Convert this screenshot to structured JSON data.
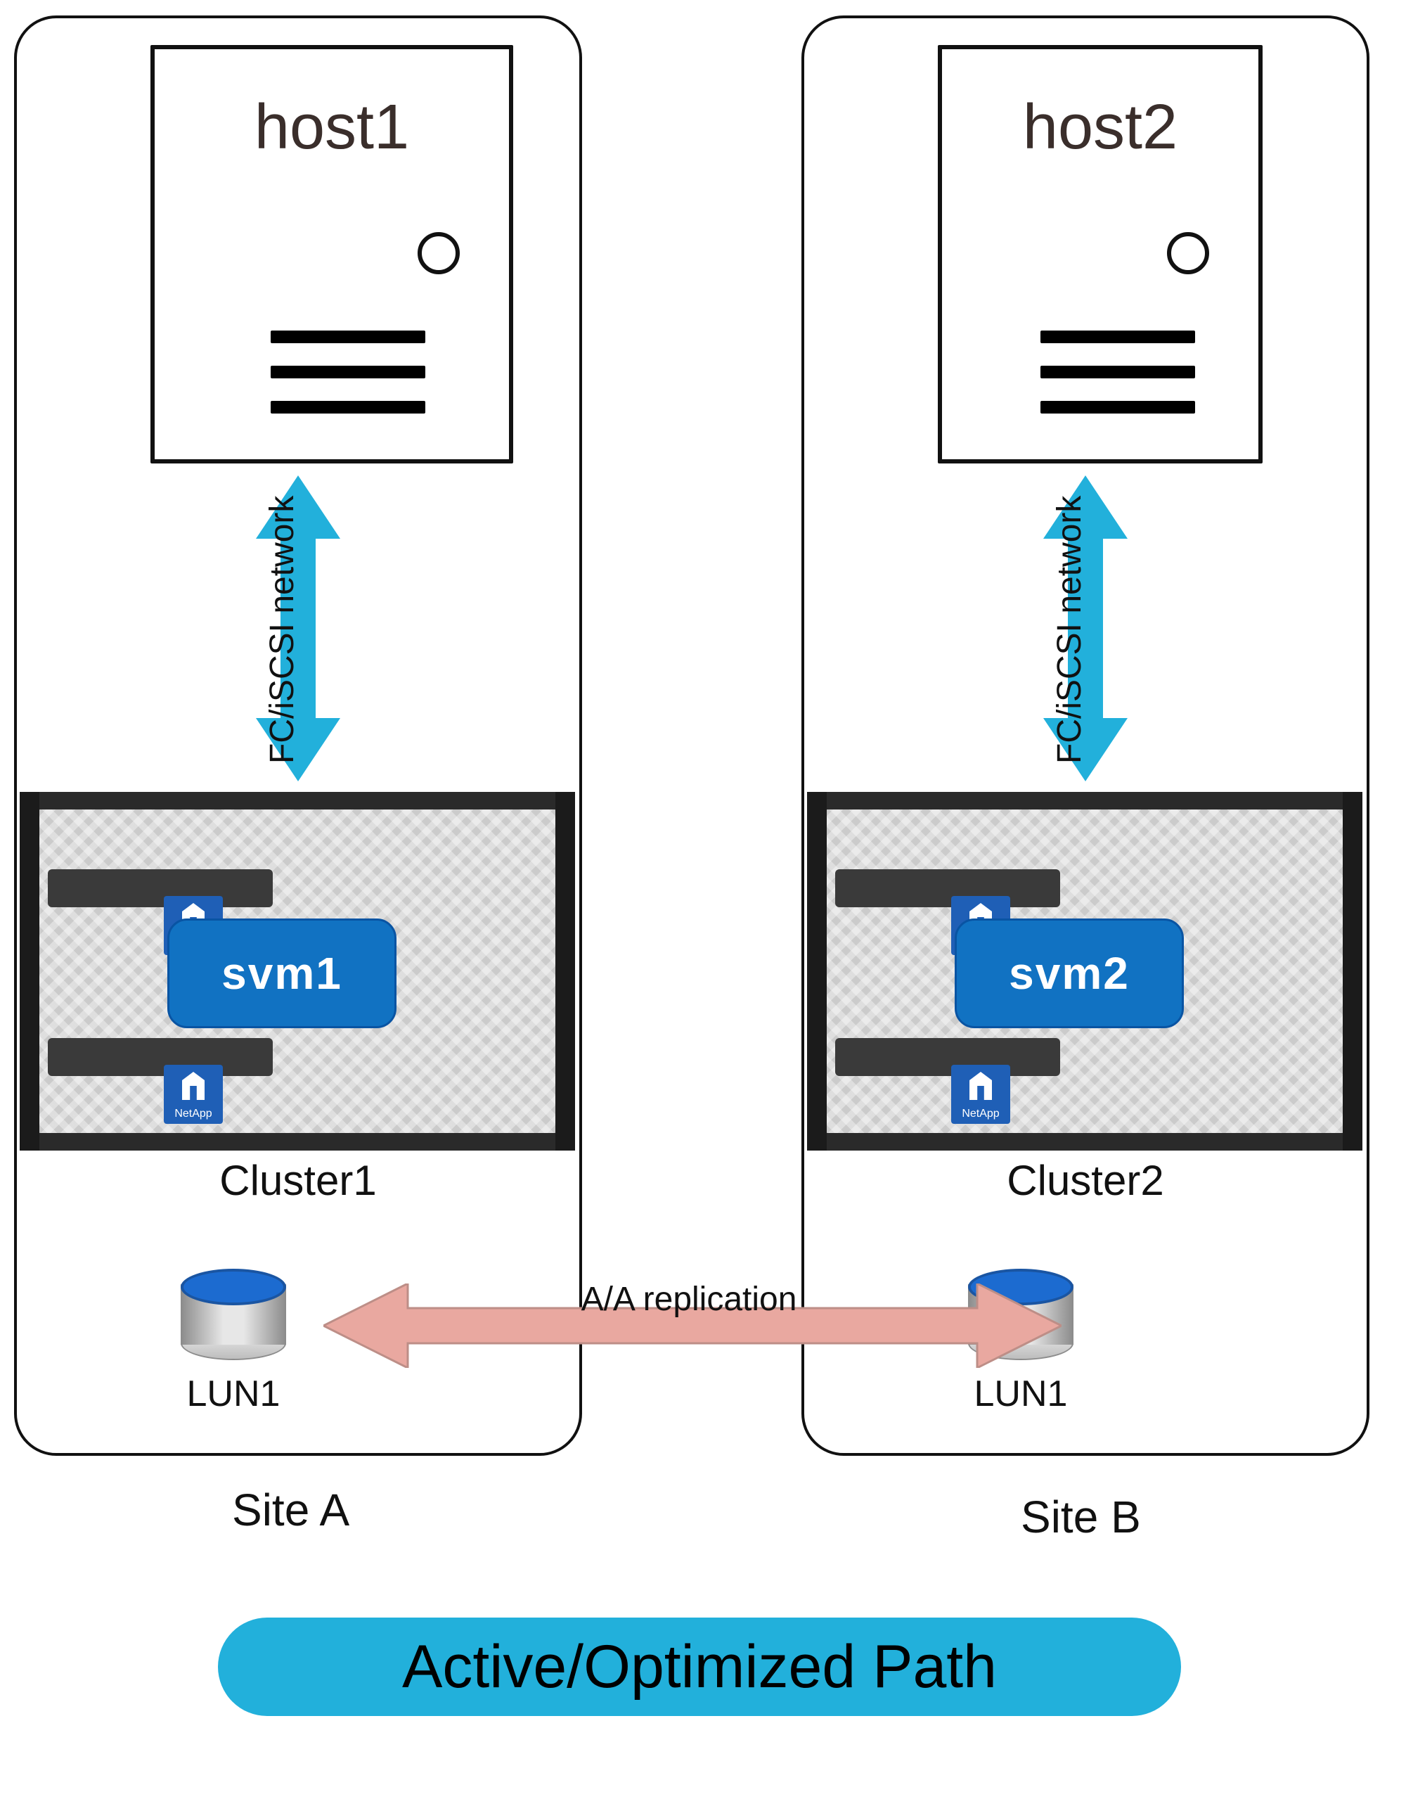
{
  "colors": {
    "network_arrow": "#22b0db",
    "replication_arrow_fill": "#e9a8a0",
    "replication_arrow_stroke": "#bd8e87",
    "svm_fill": "#1172c2",
    "lun_top": "#1c6bd0",
    "legend_pill": "#22b0db"
  },
  "connections": {
    "network_label": "FC/iSCSI network",
    "replication_label": "A/A replication"
  },
  "sites": {
    "a": {
      "caption": "Site A",
      "host": {
        "name": "host1"
      },
      "cluster": {
        "name": "Cluster1",
        "svm": "svm1",
        "vendor": "NetApp"
      },
      "lun": {
        "name": "LUN1"
      }
    },
    "b": {
      "caption": "Site B",
      "host": {
        "name": "host2"
      },
      "cluster": {
        "name": "Cluster2",
        "svm": "svm2",
        "vendor": "NetApp"
      },
      "lun": {
        "name": "LUN1"
      }
    }
  },
  "legend": {
    "active_optimized": "Active/Optimized Path"
  }
}
